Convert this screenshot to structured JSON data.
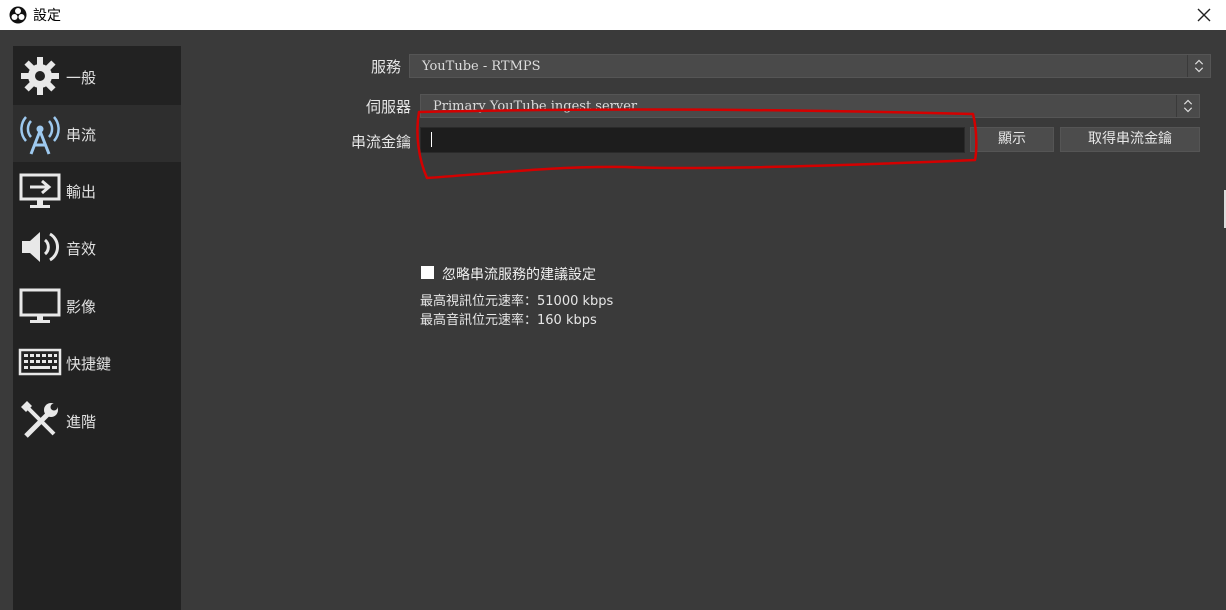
{
  "window": {
    "title": "設定",
    "close_icon": "close-icon"
  },
  "sidebar": {
    "items": [
      {
        "label": "一般",
        "icon": "gear-icon"
      },
      {
        "label": "串流",
        "icon": "antenna-icon",
        "active": true
      },
      {
        "label": "輸出",
        "icon": "output-icon"
      },
      {
        "label": "音效",
        "icon": "speaker-icon"
      },
      {
        "label": "影像",
        "icon": "monitor-icon"
      },
      {
        "label": "快捷鍵",
        "icon": "keyboard-icon"
      },
      {
        "label": "進階",
        "icon": "tools-icon"
      }
    ]
  },
  "stream": {
    "service_label": "服務",
    "service_value": "YouTube - RTMPS",
    "server_label": "伺服器",
    "server_value": "Primary YouTube ingest server",
    "key_label": "串流金鑰",
    "key_value": "",
    "show_button": "顯示",
    "get_key_button": "取得串流金鑰",
    "ignore_checkbox_label": "忽略串流服務的建議設定",
    "ignore_checked": false,
    "max_video_bitrate": "最高視訊位元速率：51000 kbps",
    "max_audio_bitrate": "最高音訊位元速率：160 kbps"
  },
  "colors": {
    "annotation": "#d40000",
    "background": "#3a3a3a",
    "sidebar": "#222222"
  }
}
